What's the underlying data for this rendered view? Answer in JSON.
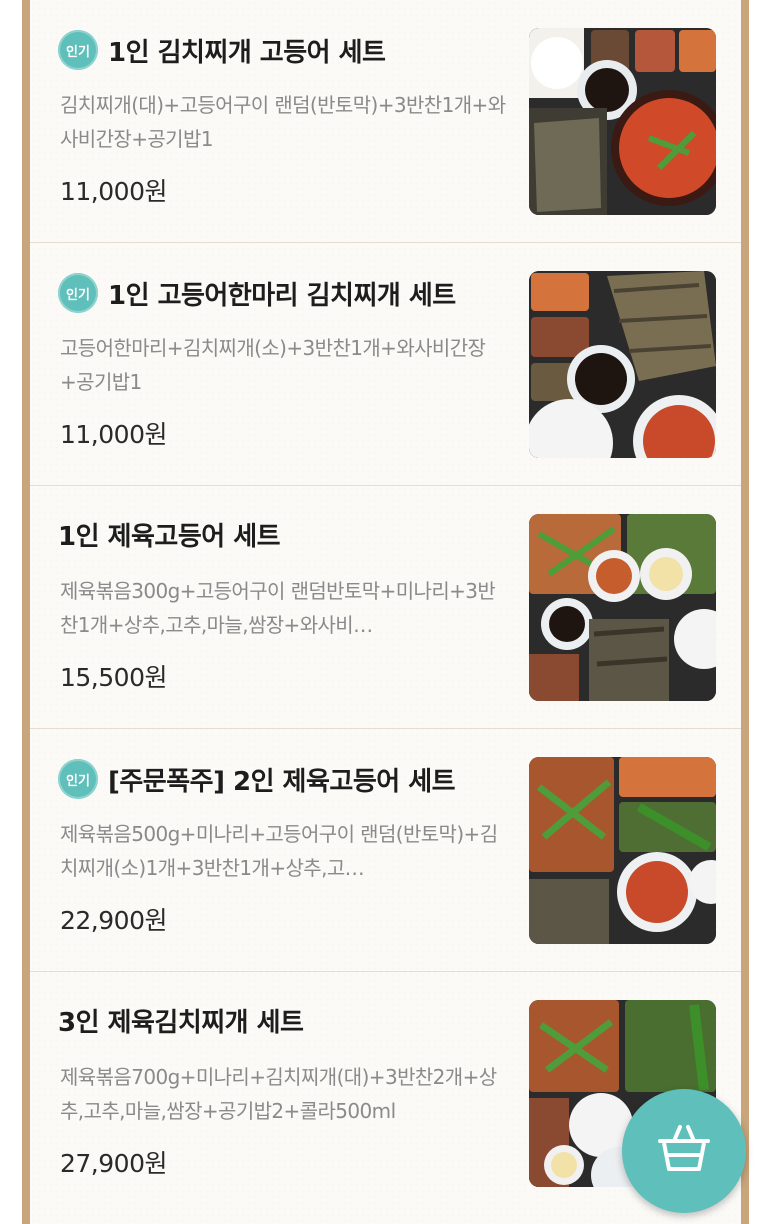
{
  "badge_label": "인기",
  "items": [
    {
      "title": "1인 김치찌개 고등어 세트",
      "popular": true,
      "description": "김치찌개(대)+고등어구이 랜덤(반토막)+3반찬1개+와사비간장+공기밥1",
      "price": "11,000원"
    },
    {
      "title": "1인 고등어한마리 김치찌개 세트",
      "popular": true,
      "description": "고등어한마리+김치찌개(소)+3반찬1개+와사비간장+공기밥1",
      "price": "11,000원"
    },
    {
      "title": "1인 제육고등어 세트",
      "popular": false,
      "description": "제육볶음300g+고등어구이 랜덤반토막+미나리+3반찬1개+상추,고추,마늘,쌈장+와사비…",
      "price": "15,500원"
    },
    {
      "title": "[주문폭주] 2인 제육고등어 세트",
      "popular": true,
      "description": "제육볶음500g+미나리+고등어구이 랜덤(반토막)+김치찌개(소)1개+3반찬1개+상추,고…",
      "price": "22,900원"
    },
    {
      "title": "3인 제육김치찌개 세트",
      "popular": false,
      "description": "제육볶음700g+미나리+김치찌개(대)+3반찬2개+상추,고추,마늘,쌈장+공기밥2+콜라500ml",
      "price": "27,900원"
    }
  ],
  "cart_icon": "basket-icon",
  "colors": {
    "accent": "#5fbfba",
    "frame": "#c8a57a"
  }
}
